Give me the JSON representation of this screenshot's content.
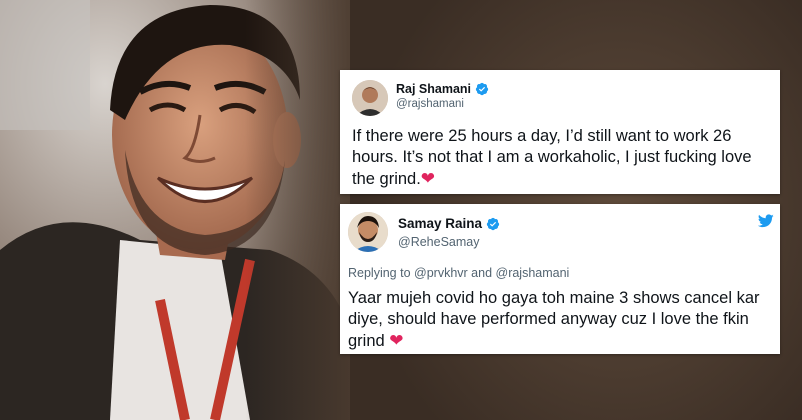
{
  "tweets": [
    {
      "name": "Raj Shamani",
      "handle": "@rajshamani",
      "text": "If there were 25 hours a day, I’d still want to work 26 hours. It’s not that I am a workaholic, I just fucking love the grind.",
      "emoji_icon": "red-heart-icon"
    },
    {
      "name": "Samay Raina",
      "handle": "@ReheSamay",
      "replying_prefix": "Replying to ",
      "replying_to_1": "@prvkhvr",
      "replying_and": " and ",
      "replying_to_2": "@rajshamani",
      "text": "Yaar mujeh covid ho gaya toh maine 3 shows cancel kar diye, should have performed anyway cuz I love the fkin grind",
      "emoji_icon": "red-heart-icon"
    }
  ],
  "colors": {
    "verified": "#1d9bf0",
    "heart": "#e0245e",
    "twitter_bird": "#1d9bf0",
    "secondary_text": "#536471"
  }
}
